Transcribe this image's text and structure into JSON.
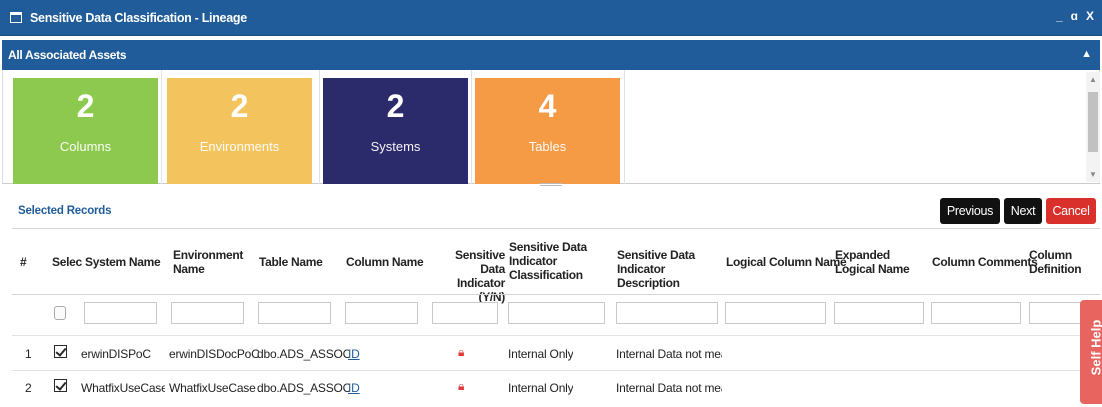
{
  "window": {
    "title": "Sensitive Data Classification - Lineage",
    "controls": [
      "_",
      "ɑ",
      "X"
    ]
  },
  "section": {
    "title": "All Associated Assets",
    "collapse_icon": "chevron-up-icon"
  },
  "tiles": [
    {
      "count": "2",
      "label": "Columns",
      "color": "#8dc94e"
    },
    {
      "count": "2",
      "label": "Environments",
      "color": "#f3c45d"
    },
    {
      "count": "2",
      "label": "Systems",
      "color": "#2b2a6b"
    },
    {
      "count": "4",
      "label": "Tables",
      "color": "#f59a45"
    }
  ],
  "records": {
    "title": "Selected Records",
    "buttons": {
      "previous": "Previous",
      "next": "Next",
      "cancel": "Cancel"
    }
  },
  "table": {
    "headers": {
      "index": "#",
      "select": "Selec",
      "system_name": "System Name",
      "environment_name": "Environment Name",
      "table_name": "Table Name",
      "column_name": "Column Name",
      "sdi": "Sensitive Data Indicator (Y/N)",
      "sdi_class": "Sensitive Data Indicator Classification",
      "sdi_desc": "Sensitive Data Indicator Description",
      "logical_column_name": "Logical Column Name",
      "expanded_logical_name": "Expanded Logical Name",
      "column_comments": "Column Comments",
      "column_definition": "Column Definition"
    },
    "rows": [
      {
        "index": "1",
        "selected": true,
        "system": "erwinDISPoC",
        "environment": "erwinDISDocPoC",
        "table": "dbo.ADS_ASSOCIA",
        "column": "ID",
        "sdi_icon": "lock-icon",
        "classification": "Internal Only",
        "description": "Internal Data not meant fo"
      },
      {
        "index": "2",
        "selected": true,
        "system": "WhatfixUseCase",
        "environment": "WhatfixUseCase",
        "table": "dbo.ADS_ASSOCIA",
        "column": "ID",
        "sdi_icon": "lock-icon",
        "classification": "Internal Only",
        "description": "Internal Data not meant fo"
      }
    ]
  },
  "self_help": {
    "label": "Self Help",
    "color": "#e8655f"
  }
}
